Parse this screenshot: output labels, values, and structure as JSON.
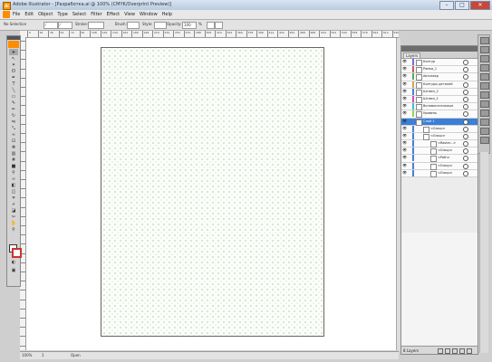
{
  "window": {
    "title": "Adobe Illustrator - [Разработка.ai @ 100% (CMYK/Overprint Preview)]"
  },
  "menu": [
    "File",
    "Edit",
    "Object",
    "Type",
    "Select",
    "Filter",
    "Effect",
    "View",
    "Window",
    "Help"
  ],
  "control": {
    "selection": "No Selection",
    "stroke": "Stroke:",
    "brush": "Brush:",
    "style": "Style:",
    "opacity_label": "Opacity:",
    "opacity": "100",
    "percent": "%"
  },
  "status": {
    "zoom": "100%",
    "page": "1",
    "state": "Open"
  },
  "ruler": [
    "0",
    "18",
    "36",
    "54",
    "72",
    "90",
    "108",
    "126",
    "144",
    "162",
    "180",
    "198",
    "216",
    "234",
    "252",
    "270",
    "288",
    "306",
    "324",
    "342",
    "360",
    "378",
    "396",
    "414",
    "432",
    "450",
    "468",
    "486",
    "504",
    "522",
    "540",
    "558",
    "576",
    "594",
    "612",
    "630"
  ],
  "layers": {
    "tab": "Layers",
    "count": "8 Layers",
    "rows": [
      {
        "name": "Контур",
        "indent": 0,
        "color": "#7a6ad8"
      },
      {
        "name": "Рамка_1",
        "indent": 0,
        "color": "#c85a5a"
      },
      {
        "name": "Автозакр",
        "indent": 0,
        "color": "#5aa85a"
      },
      {
        "name": "Контуры деталей",
        "indent": 0,
        "color": "#d8a14a"
      },
      {
        "name": "Штамп_2",
        "indent": 0,
        "color": "#4a7ed8"
      },
      {
        "name": "Штамп_1",
        "indent": 0,
        "color": "#d84ab4"
      },
      {
        "name": "Вспомогательные",
        "indent": 0,
        "color": "#3fbad8"
      },
      {
        "name": "Уровень",
        "indent": 0,
        "color": "#8ad84a"
      },
      {
        "name": "Слой 1",
        "indent": 0,
        "color": "#4a7ed8",
        "selected": true
      },
      {
        "name": "<Group>",
        "indent": 1,
        "color": "#4a7ed8"
      },
      {
        "name": "<Group>",
        "indent": 1,
        "color": "#4a7ed8"
      },
      {
        "name": "<Raster...>",
        "indent": 2,
        "color": "#4a7ed8"
      },
      {
        "name": "<Group>",
        "indent": 2,
        "color": "#4a7ed8"
      },
      {
        "name": "<Path>",
        "indent": 2,
        "color": "#4a7ed8"
      },
      {
        "name": "<Group>",
        "indent": 2,
        "color": "#4a7ed8"
      },
      {
        "name": "<Group>",
        "indent": 2,
        "color": "#4a7ed8"
      }
    ]
  }
}
